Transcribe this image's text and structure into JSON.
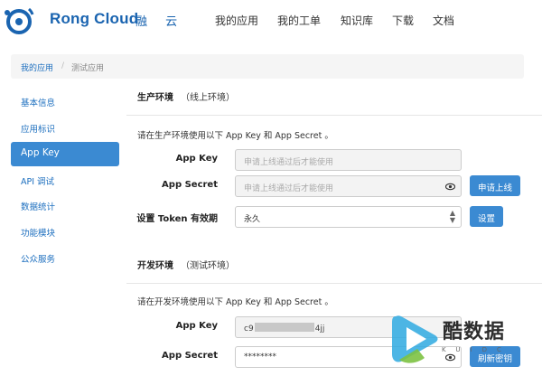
{
  "header": {
    "brand": "Rong Cloud",
    "brand_cn": "融 云",
    "nav": [
      "我的应用",
      "我的工单",
      "知识库",
      "下载",
      "文档"
    ]
  },
  "breadcrumb": {
    "root": "我的应用",
    "separator": "/",
    "current": "测试应用"
  },
  "sidebar": {
    "items": [
      {
        "label": "基本信息"
      },
      {
        "label": "应用标识"
      },
      {
        "label": "App Key"
      },
      {
        "label": "API 调试"
      },
      {
        "label": "数据统计"
      },
      {
        "label": "功能模块"
      },
      {
        "label": "公众服务"
      }
    ],
    "active_index": 2
  },
  "production": {
    "title": "生产环境",
    "subtitle": "（线上环境）",
    "description": "请在生产环境使用以下 App Key 和 App Secret 。",
    "app_key_label": "App Key",
    "app_key_placeholder": "申请上线通过后才能使用",
    "app_secret_label": "App Secret",
    "app_secret_placeholder": "申请上线通过后才能使用",
    "apply_button": "申请上线",
    "token_label": "设置 Token 有效期",
    "token_value": "永久",
    "settings_button": "设置"
  },
  "development": {
    "title": "开发环境",
    "subtitle": "（测试环境）",
    "description": "请在开发环境使用以下 App Key 和 App Secret 。",
    "app_key_label": "App Key",
    "app_key_prefix": "c9",
    "app_key_suffix": "4jj",
    "app_secret_label": "App Secret",
    "app_secret_value": "********",
    "refresh_button": "刷新密钥"
  },
  "watermark": {
    "text": "酷数据",
    "sub": "KUIDC"
  },
  "colors": {
    "brand": "#1a64b0",
    "accent": "#3b8ad2",
    "link": "#1d6fbf"
  }
}
